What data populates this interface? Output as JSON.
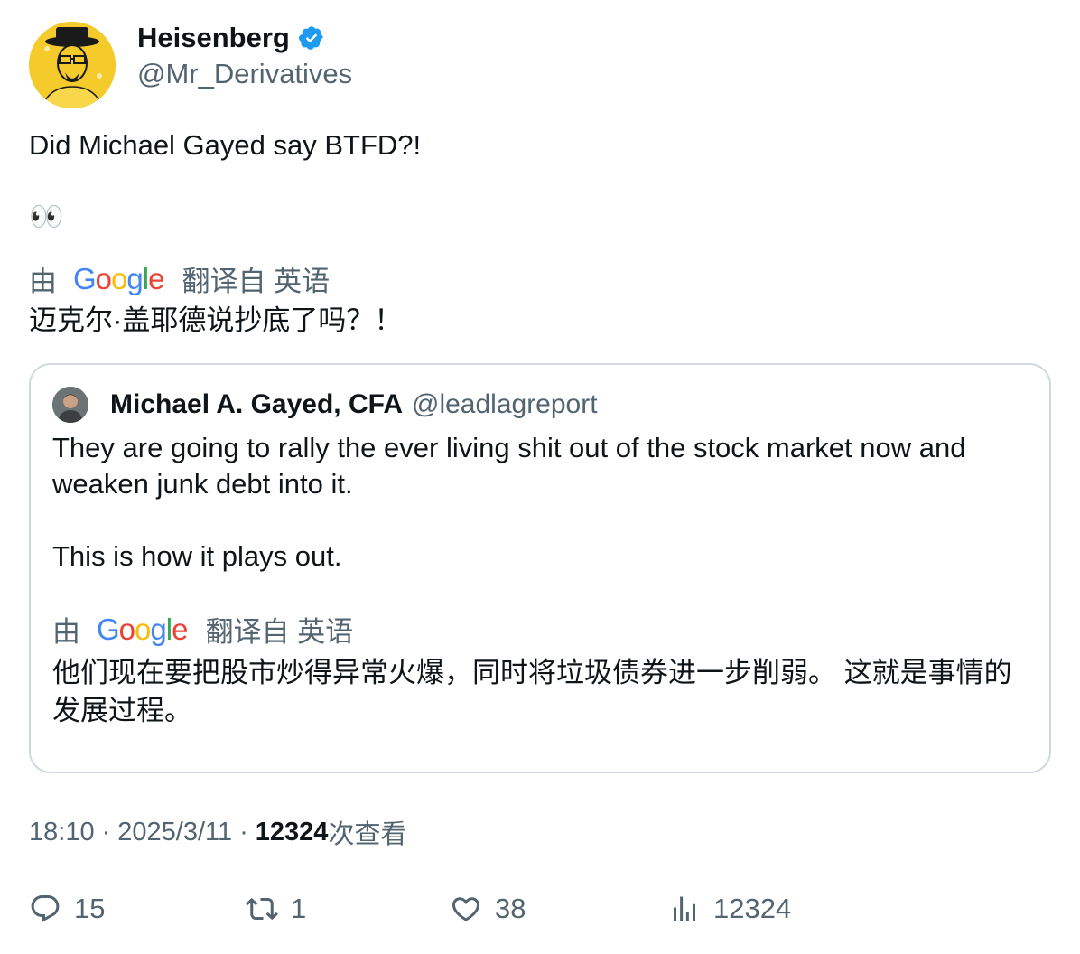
{
  "author": {
    "name": "Heisenberg",
    "handle": "@Mr_Derivatives",
    "verified": true
  },
  "tweet": {
    "text_line1": "Did Michael Gayed say BTFD?!",
    "text_line2": "👀",
    "translation": {
      "by_label": "由",
      "provider": "Google",
      "translated_from": "翻译自 英语",
      "text": "迈克尔·盖耶德说抄底了吗？！"
    }
  },
  "quote": {
    "author_name": "Michael A. Gayed, CFA",
    "author_handle": "@leadlagreport",
    "text_para1": "They are going to rally the ever living shit out of the stock market now and weaken junk debt into it.",
    "text_para2": "This is how it plays out.",
    "translation": {
      "by_label": "由",
      "provider": "Google",
      "translated_from": "翻译自 英语",
      "text": "他们现在要把股市炒得异常火爆，同时将垃圾债券进一步削弱。 这就是事情的发展过程。"
    }
  },
  "meta": {
    "time": "18:10",
    "date": "2025/3/11",
    "separator": "·",
    "views_count": "12324",
    "views_label": "次查看"
  },
  "actions": {
    "replies": "15",
    "retweets": "1",
    "likes": "38",
    "views": "12324"
  },
  "colors": {
    "verified_blue": "#1d9bf0",
    "secondary_text": "#536471",
    "border": "#cfd9de",
    "avatar_yellow": "#f5cb2b"
  }
}
